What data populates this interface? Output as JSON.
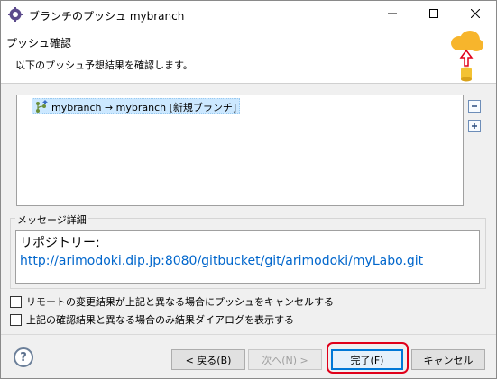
{
  "window": {
    "title": "ブランチのプッシュ mybranch",
    "controls": [
      "minimize-icon",
      "maximize-icon",
      "close-icon"
    ]
  },
  "header": {
    "title": "プッシュ確認",
    "description": "以下のプッシュ予想結果を確認します。",
    "image_icon": "cloud-push-icon"
  },
  "tree": {
    "items": [
      {
        "label": "mybranch → mybranch [新規ブランチ]",
        "icon": "branch-push-icon",
        "selected": true
      }
    ],
    "tools": [
      "collapse-all-icon",
      "expand-all-icon"
    ]
  },
  "message": {
    "legend": "メッセージ詳細",
    "line1": "リポジトリー:",
    "link": "http://arimodoki.dip.jp:8080/gitbucket/git/arimodoki/myLabo.git"
  },
  "options": {
    "cancel_on_change": {
      "label": "リモートの変更結果が上記と異なる場合にプッシュをキャンセルする",
      "checked": false
    },
    "show_dialog_on_diff": {
      "label": "上記の確認結果と異なる場合のみ結果ダイアログを表示する",
      "checked": false
    }
  },
  "buttons": {
    "help": "?",
    "back": "< 戻る(B)",
    "next": "次へ(N) >",
    "finish": "完了(F)",
    "cancel": "キャンセル"
  },
  "colors": {
    "accent": "#0078d7",
    "highlight_frame": "#e0001a",
    "link": "#0066cc",
    "selection": "#cce8ff"
  }
}
